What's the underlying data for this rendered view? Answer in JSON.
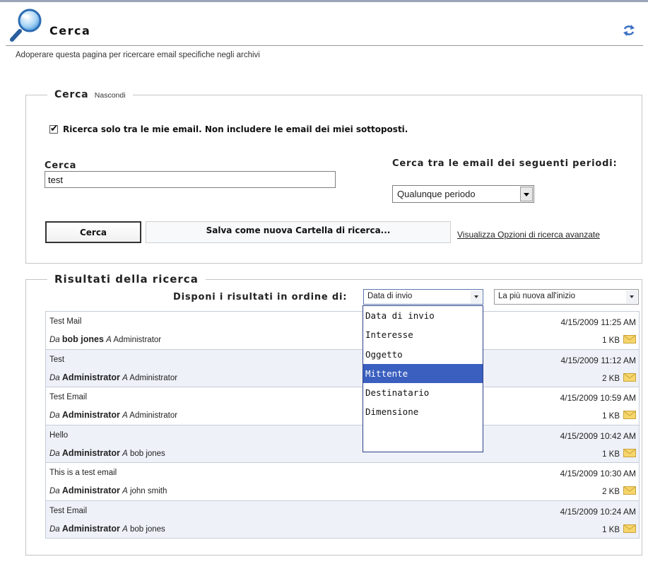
{
  "header": {
    "title": "Cerca",
    "intro": "Adoperare questa pagina per ricercare email specifiche negli archivi"
  },
  "search_section": {
    "legend": "Cerca",
    "hide_link": "Nascondi",
    "only_mine_label": "Ricerca solo tra le mie email. Non includere le email dei miei sottoposti.",
    "only_mine_checked": true,
    "search_label": "Cerca",
    "search_value": "test",
    "period_label": "Cerca tra le email dei seguenti periodi:",
    "period_value": "Qualunque periodo",
    "search_button": "Cerca",
    "save_button": "Salva come nuova Cartella di ricerca...",
    "advanced_link": "Visualizza Opzioni di ricerca avanzate"
  },
  "results_section": {
    "legend": "Risultati della ricerca",
    "sort_label": "Disponi i risultati in ordine di:",
    "sort_by_value": "Data di invio",
    "sort_order_value": "La più nuova all'inizio",
    "sort_options": [
      "Data di invio",
      "Interesse",
      "Oggetto",
      "Mittente",
      "Destinatario",
      "Dimensione"
    ],
    "highlighted_option": "Mittente",
    "from_prefix": "Da",
    "to_prefix": "A",
    "rows": [
      {
        "subject": "Test Mail",
        "from": "bob jones",
        "to": "Administrator",
        "date": "4/15/2009 11:25 AM",
        "size": "1 KB"
      },
      {
        "subject": "Test",
        "from": "Administrator",
        "to": "Administrator",
        "date": "4/15/2009 11:12 AM",
        "size": "2 KB"
      },
      {
        "subject": "Test Email",
        "from": "Administrator",
        "to": "Administrator",
        "date": "4/15/2009 10:59 AM",
        "size": "1 KB"
      },
      {
        "subject": "Hello",
        "from": "Administrator",
        "to": "bob jones",
        "date": "4/15/2009 10:42 AM",
        "size": "1 KB"
      },
      {
        "subject": "This is a test email",
        "from": "Administrator",
        "to": "john smith",
        "date": "4/15/2009 10:30 AM",
        "size": "2 KB"
      },
      {
        "subject": "Test Email",
        "from": "Administrator",
        "to": "bob jones",
        "date": "4/15/2009 10:24 AM",
        "size": "1 KB"
      }
    ]
  },
  "icons": {
    "logo": "magnifier-icon",
    "refresh": "refresh-icon",
    "message": "envelope-icon"
  },
  "colors": {
    "row_alt_background": "#eef1f8",
    "dropdown_highlight": "#3a5fbf",
    "envelope": "#f2c94c"
  }
}
